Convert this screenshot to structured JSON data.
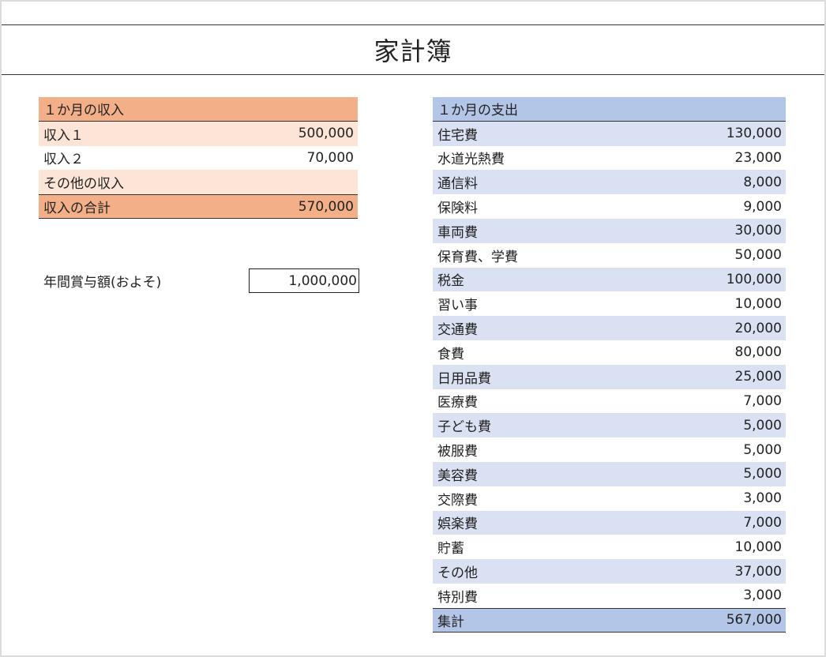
{
  "title": "家計簿",
  "income": {
    "header": "１か月の収入",
    "rows": [
      {
        "label": "収入１",
        "value": "500,000"
      },
      {
        "label": "収入２",
        "value": "70,000"
      },
      {
        "label": "その他の収入",
        "value": ""
      }
    ],
    "total": {
      "label": "収入の合計",
      "value": "570,000"
    }
  },
  "bonus": {
    "label": "年間賞与額(およそ)",
    "value": "1,000,000"
  },
  "expense": {
    "header": "１か月の支出",
    "rows": [
      {
        "label": "住宅費",
        "value": "130,000"
      },
      {
        "label": "水道光熱費",
        "value": "23,000"
      },
      {
        "label": "通信料",
        "value": "8,000"
      },
      {
        "label": "保険料",
        "value": "9,000"
      },
      {
        "label": "車両費",
        "value": "30,000"
      },
      {
        "label": "保育費、学費",
        "value": "50,000"
      },
      {
        "label": "税金",
        "value": "100,000"
      },
      {
        "label": "習い事",
        "value": "10,000"
      },
      {
        "label": "交通費",
        "value": "20,000"
      },
      {
        "label": "食費",
        "value": "80,000"
      },
      {
        "label": "日用品費",
        "value": "25,000"
      },
      {
        "label": "医療費",
        "value": "7,000"
      },
      {
        "label": "子ども費",
        "value": "5,000"
      },
      {
        "label": "被服費",
        "value": "5,000"
      },
      {
        "label": "美容費",
        "value": "5,000"
      },
      {
        "label": "交際費",
        "value": "3,000"
      },
      {
        "label": "娯楽費",
        "value": "7,000"
      },
      {
        "label": "貯蓄",
        "value": "10,000"
      },
      {
        "label": "その他",
        "value": "37,000"
      },
      {
        "label": "特別費",
        "value": "3,000"
      }
    ],
    "total": {
      "label": "集計",
      "value": "567,000"
    }
  },
  "colors": {
    "income_dark": "#f2af88",
    "income_light": "#fce4d6",
    "expense_dark": "#b4c6e7",
    "expense_light": "#d9e1f2"
  }
}
